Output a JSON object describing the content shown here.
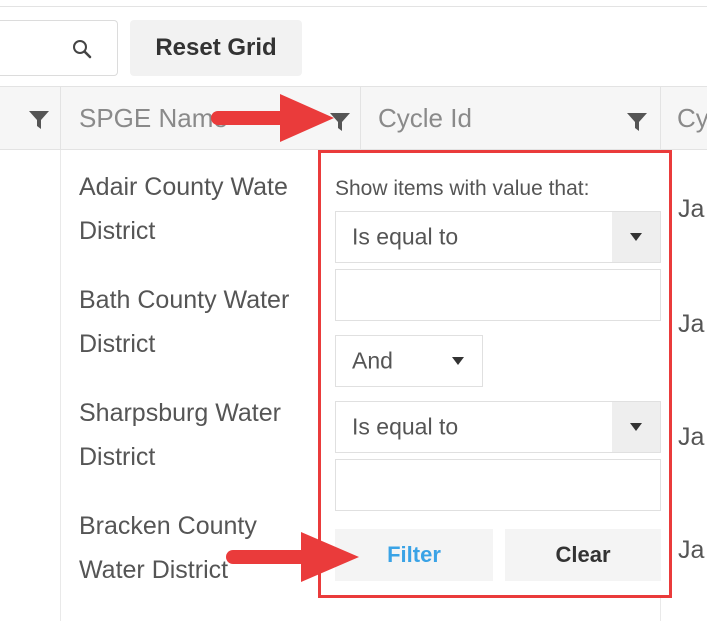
{
  "toolbar": {
    "search_icon": "search-icon",
    "reset_label": "Reset Grid"
  },
  "grid": {
    "columns": [
      {
        "label": ""
      },
      {
        "label": "SPGE Name"
      },
      {
        "label": "Cycle Id"
      },
      {
        "label": "Cy"
      }
    ],
    "rows": [
      {
        "line1": "Adair County Wate",
        "line2": "District",
        "cycle": "Ja"
      },
      {
        "line1": "Bath County Water",
        "line2": "District",
        "cycle": "Ja"
      },
      {
        "line1": "Sharpsburg Water",
        "line2": "District",
        "cycle": "Ja"
      },
      {
        "line1": "Bracken County",
        "line2": "Water District",
        "cycle": "Ja"
      }
    ]
  },
  "filter_popup": {
    "title": "Show items with value that:",
    "operator1": "Is equal to",
    "value1": "",
    "logic": "And",
    "operator2": "Is equal to",
    "value2": "",
    "filter_label": "Filter",
    "clear_label": "Clear"
  },
  "colors": {
    "highlight": "#ea3b3b",
    "filter_button_text": "#3aa3e6"
  }
}
